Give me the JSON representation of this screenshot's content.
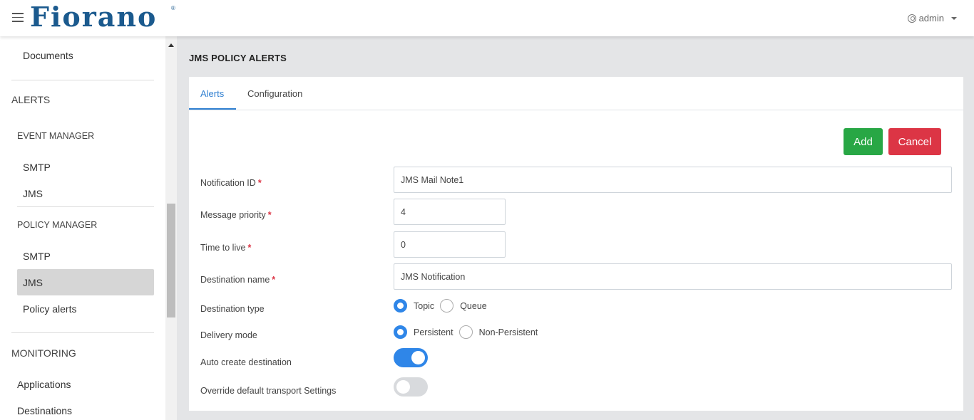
{
  "header": {
    "logo_text": "Fiorano",
    "logo_mark": "®",
    "user_label": "admin",
    "colors": {
      "brand": "#1b5a8e"
    }
  },
  "sidebar": {
    "documents": "Documents",
    "alerts_heading": "ALERTS",
    "event_manager": "EVENT MANAGER",
    "event_smtp": "SMTP",
    "event_jms": "JMS",
    "policy_manager": "POLICY MANAGER",
    "policy_smtp": "SMTP",
    "policy_jms": "JMS",
    "policy_alerts": "Policy alerts",
    "monitoring_heading": "MONITORING",
    "applications": "Applications",
    "destinations": "Destinations"
  },
  "page": {
    "title": "JMS POLICY ALERTS",
    "tabs": [
      {
        "label": "Alerts",
        "active": true
      },
      {
        "label": "Configuration",
        "active": false
      }
    ],
    "buttons": {
      "add": "Add",
      "cancel": "Cancel"
    },
    "form": {
      "notification_id_label": "Notification ID",
      "notification_id_value": "JMS Mail Note1",
      "message_priority_label": "Message priority",
      "message_priority_value": "4",
      "time_to_live_label": "Time to live",
      "time_to_live_value": "0",
      "destination_name_label": "Destination name",
      "destination_name_value": "JMS Notification",
      "destination_type_label": "Destination type",
      "destination_type_options": [
        "Topic",
        "Queue"
      ],
      "destination_type_selected": "Topic",
      "delivery_mode_label": "Delivery mode",
      "delivery_mode_options": [
        "Persistent",
        "Non-Persistent"
      ],
      "delivery_mode_selected": "Persistent",
      "auto_create_label": "Auto create destination",
      "auto_create_on": true,
      "override_label": "Override default transport Settings",
      "override_on": false,
      "required_mark": "*"
    },
    "colors": {
      "accent": "#2f86e8",
      "add": "#28a745",
      "cancel": "#dc3545"
    }
  }
}
